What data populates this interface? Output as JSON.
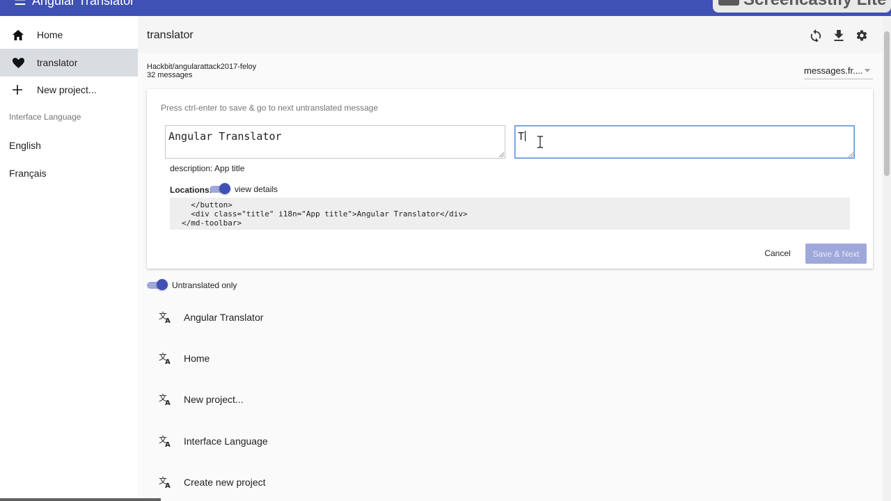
{
  "app": {
    "title": "Angular Translator",
    "watermark": "Screencastify Lite"
  },
  "sidebar": {
    "items": [
      {
        "label": "Home",
        "icon": "home-icon"
      },
      {
        "label": "translator",
        "icon": "heart-icon",
        "active": true
      },
      {
        "label": "New project...",
        "icon": "plus-icon"
      }
    ],
    "subheader": "Interface Language",
    "languages": [
      "English",
      "Français"
    ]
  },
  "header": {
    "title": "translator",
    "actions": [
      "sync-icon",
      "download-icon",
      "settings-icon"
    ]
  },
  "project": {
    "repo": "Hackbit/angularattack2017-feloy",
    "count": "32 messages",
    "file": "messages.fr...."
  },
  "editor": {
    "hint": "Press ctrl-enter to save & go to next untranslated message",
    "source": "Angular Translator",
    "target": "T",
    "description": "description: App title",
    "locations_label": "Locations:",
    "view_details": "view details",
    "code_lines": [
      "  </button>",
      "  <div class=\"title\" i18n=\"App title\">Angular Translator</div>",
      "</md-toolbar>"
    ],
    "cancel": "Cancel",
    "save": "Save & Next"
  },
  "filter": {
    "untranslated_only": "Untranslated only"
  },
  "messages": [
    "Angular Translator",
    "Home",
    "New project...",
    "Interface Language",
    "Create new project"
  ],
  "colors": {
    "primary": "#3f51b5",
    "primary_light": "#9fa8da",
    "active_nav": "#d9dde1"
  }
}
